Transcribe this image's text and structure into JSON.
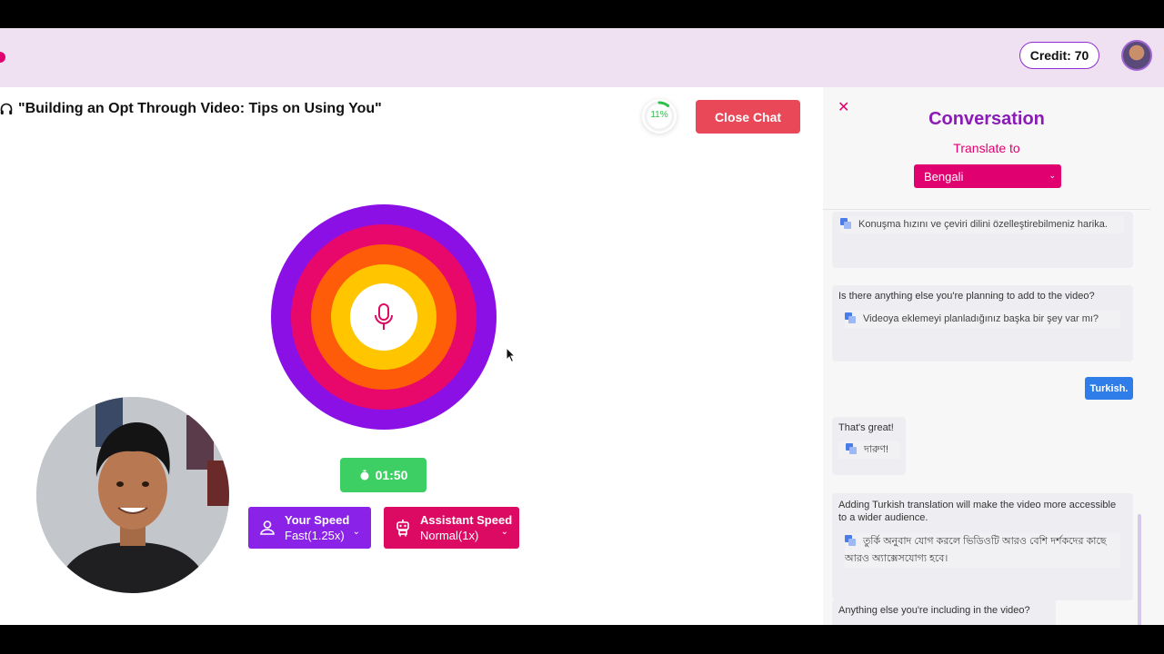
{
  "header": {
    "credit": "Credit: 70"
  },
  "main": {
    "title": "\"Building an Opt Through Video: Tips on Using You\"",
    "progress_label": "11%",
    "progress_fraction": 0.11,
    "close_chat_label": "Close Chat",
    "timer": "01:50",
    "your_speed": {
      "title": "Your Speed",
      "value": "Fast(1.25x)"
    },
    "assistant_speed": {
      "title": "Assistant Speed",
      "value": "Normal(1x)"
    }
  },
  "panel": {
    "title": "Conversation",
    "translate_label": "Translate to",
    "language": "Bengali",
    "messages": [
      {
        "text": "",
        "translation": "Konuşma hızını ve çeviri dilini özelleştirebilmeniz harika."
      },
      {
        "text": "Is there anything else you're planning to add to the video?",
        "translation": "Videoya eklemeyi planladığınız başka bir şey var mı?"
      },
      {
        "user": "Turkish."
      },
      {
        "text": "That's great!",
        "translation": "দারুণ!"
      },
      {
        "text": "Adding Turkish translation will make the video more accessible to a wider audience.",
        "translation": "তুর্কি অনুবাদ যোগ করলে ভিডিওটি আরও বেশি দর্শকদের কাছে আরও অ্যাক্সেসযোগ্য হবে।"
      },
      {
        "text": "Anything else you're including in the video?"
      }
    ]
  },
  "colors": {
    "accent_pink": "#e0006f",
    "accent_purple": "#8b22e8",
    "close_red": "#e84858",
    "timer_green": "#3ecf64",
    "user_blue": "#2f7de8"
  },
  "icons": [
    "headphones-icon",
    "microphone-icon",
    "stopwatch-icon",
    "user-icon",
    "robot-icon",
    "chevron-down-icon",
    "close-icon",
    "translate-icon",
    "mouse-cursor-icon"
  ]
}
